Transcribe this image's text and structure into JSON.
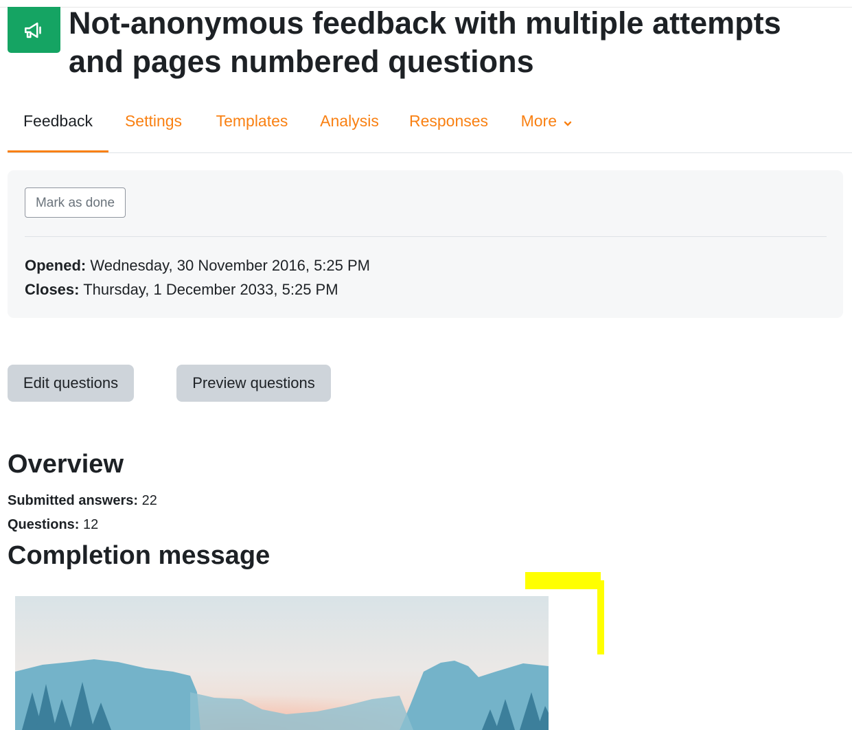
{
  "header": {
    "title": "Not-anonymous feedback with multiple attempts and pages numbered questions",
    "icon": "megaphone-icon",
    "icon_bg": "#15a463"
  },
  "tabs": [
    {
      "label": "Feedback",
      "active": true
    },
    {
      "label": "Settings",
      "active": false
    },
    {
      "label": "Templates",
      "active": false
    },
    {
      "label": "Analysis",
      "active": false
    },
    {
      "label": "Responses",
      "active": false
    },
    {
      "label": "More",
      "active": false
    }
  ],
  "info": {
    "mark_done": "Mark as done",
    "opened_label": "Opened:",
    "opened_value": "Wednesday, 30 November 2016, 5:25 PM",
    "closes_label": "Closes:",
    "closes_value": "Thursday, 1 December 2033, 5:25 PM"
  },
  "actions": {
    "edit": "Edit questions",
    "preview": "Preview questions"
  },
  "overview": {
    "heading": "Overview",
    "submitted_label": "Submitted answers:",
    "submitted_value": "22",
    "questions_label": "Questions:",
    "questions_value": "12"
  },
  "completion": {
    "heading": "Completion message"
  },
  "colors": {
    "accent": "#f98012",
    "highlight": "#ffff00"
  }
}
